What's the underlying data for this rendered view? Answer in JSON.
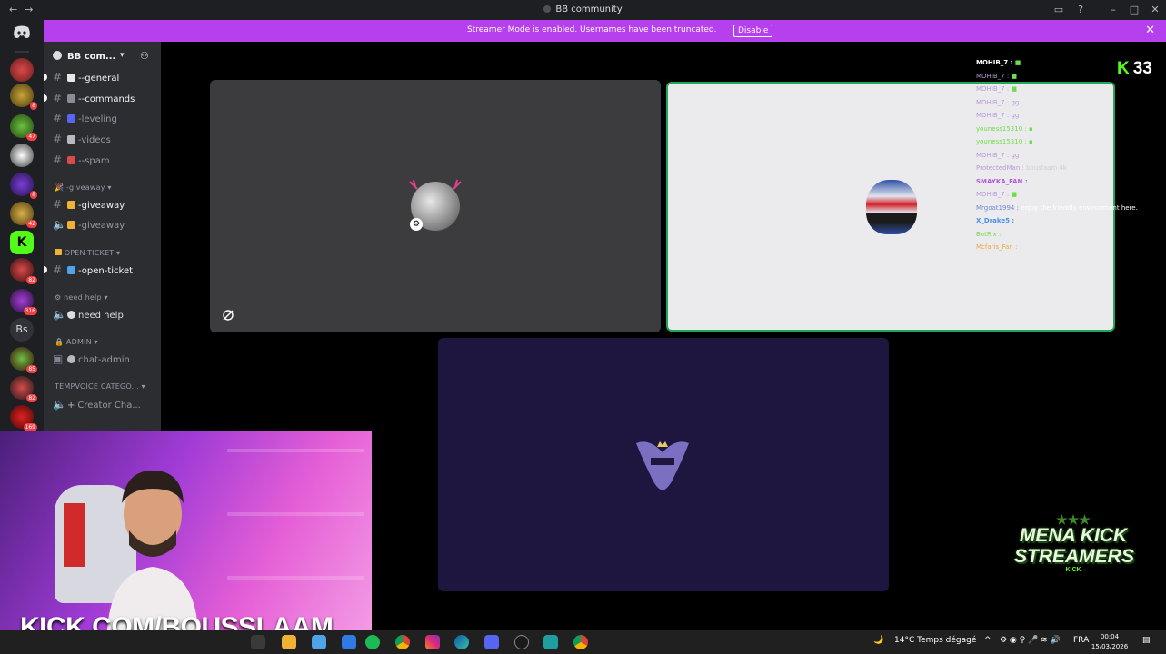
{
  "window": {
    "title": "BB community"
  },
  "banner": {
    "text": "Streamer Mode is enabled. Usernames have been truncated.",
    "disable_label": "Disable"
  },
  "server": {
    "name": "BB com..."
  },
  "rail": {
    "badges": [
      "8",
      "47",
      "8",
      "42",
      "82",
      "316",
      "85",
      "82",
      "169"
    ],
    "bs_label": "Bs"
  },
  "channels": {
    "general": "--general",
    "commands": "--commands",
    "leveling": "-leveling",
    "videos": "-videos",
    "spam": "--spam",
    "cat_giveaway": "-giveaway",
    "giveaway_text": "-giveaway",
    "giveaway_voice": "-giveaway",
    "cat_ticket": "OPEN-TICKET",
    "open_ticket": "-open-ticket",
    "cat_help": "need help",
    "need_help": "need help",
    "cat_admin": "ADMIN",
    "chat_admin": "chat-admin",
    "cat_tempvoice": "TEMPVOICE CATEGO...",
    "creator": "Creator Cha..."
  },
  "overlay": {
    "viewer_count": "33",
    "chat": [
      {
        "user": "MOHIB_7 :",
        "msg": ""
      },
      {
        "user": "MOHIB_7 :",
        "msg": ""
      },
      {
        "user": "MOHIB_7 :",
        "msg": ""
      },
      {
        "user": "MOHIB_7 :",
        "msg": "gg"
      },
      {
        "user": "MOHIB_7 :",
        "msg": "gg"
      },
      {
        "user": "youness15310 :",
        "msg": ""
      },
      {
        "user": "youness15310 :",
        "msg": ""
      },
      {
        "user": "MOHIB_7 :",
        "msg": "gg"
      },
      {
        "user": "ProtectedMan :",
        "msg": "bouslaam 4k"
      },
      {
        "user": "SMAYKA_FAN :",
        "msg": ""
      },
      {
        "user": "MOHIB_7 :",
        "msg": ""
      },
      {
        "user": "Mrgoat1994 :",
        "msg": "enjoy the friendly environment here."
      },
      {
        "user": "X_Drake5 :",
        "msg": ""
      },
      {
        "user": "BotRix :",
        "msg": ""
      },
      {
        "user": "Mcfaris_Fan :",
        "msg": ""
      }
    ],
    "url": "KICK.COM/BOUSSLAAM",
    "mena": {
      "line1": "MENA KICK",
      "line2": "STREAMERS",
      "line3": "KICK"
    }
  },
  "taskbar": {
    "weather": "14°C  Temps dégagé",
    "lang": "FRA",
    "time": "00:04",
    "date": "15/03/2026"
  },
  "colors": {
    "kick_green": "#53fc18",
    "banner": "#b63fee",
    "speaking": "#23a55a"
  }
}
